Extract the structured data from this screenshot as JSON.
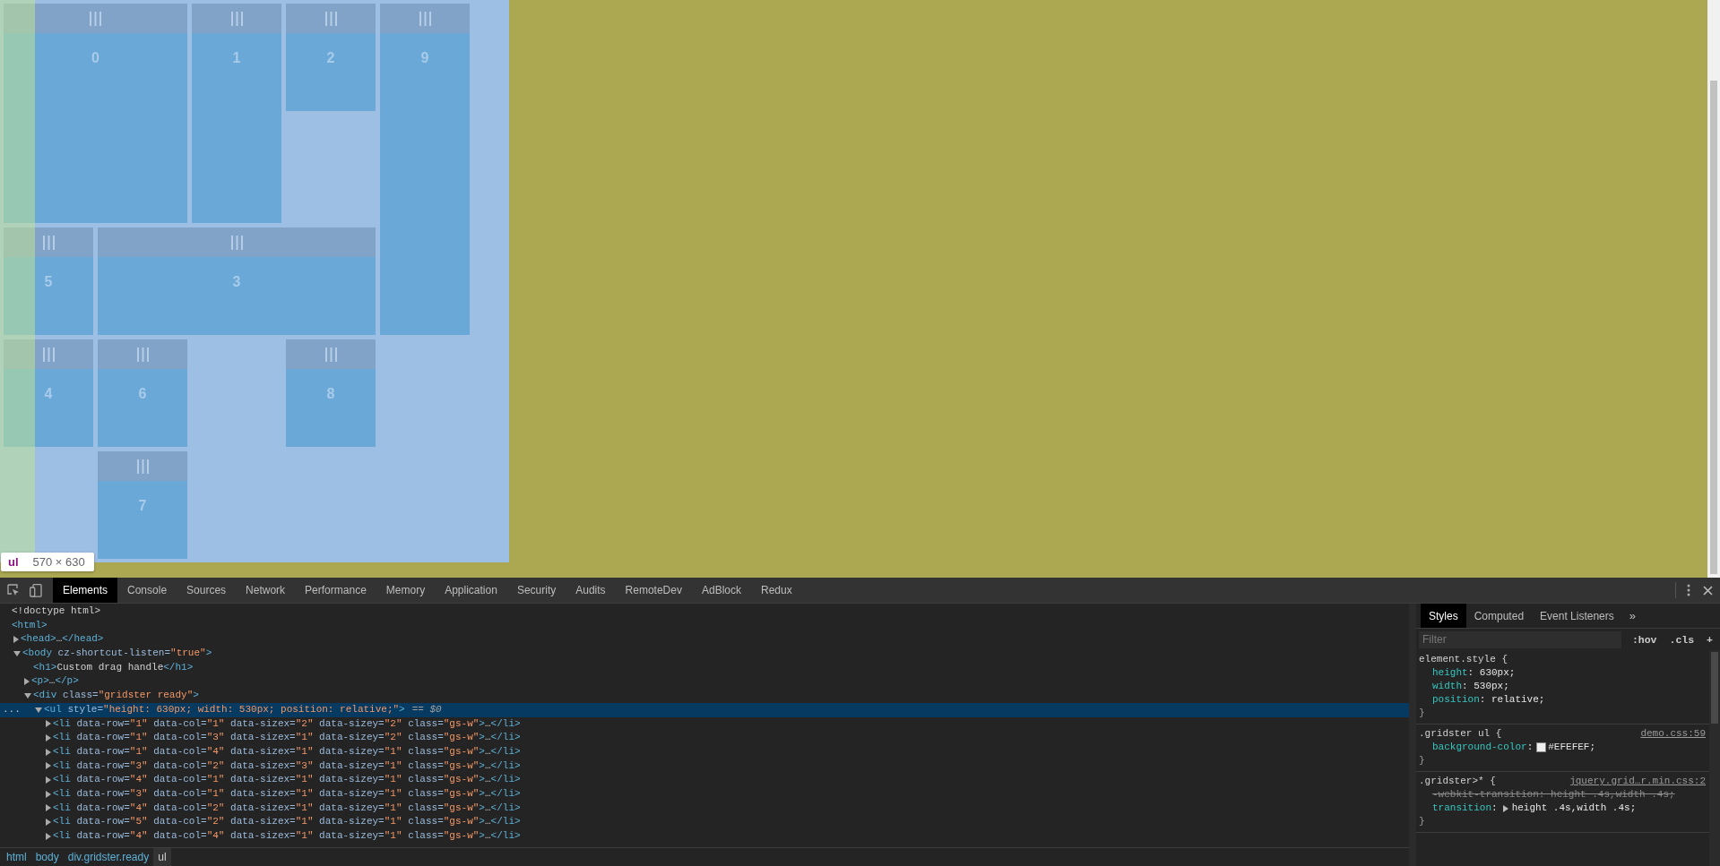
{
  "page": {
    "inspect_tooltip": {
      "tag": "ul",
      "size": "570 × 630"
    },
    "tiles": [
      {
        "label": "0"
      },
      {
        "label": "1"
      },
      {
        "label": "2"
      },
      {
        "label": "9"
      },
      {
        "label": "5"
      },
      {
        "label": "3"
      },
      {
        "label": "4"
      },
      {
        "label": "6"
      },
      {
        "label": "8"
      },
      {
        "label": "7"
      }
    ]
  },
  "devtools": {
    "tabs": [
      {
        "label": "Elements",
        "selected": true
      },
      {
        "label": "Console",
        "selected": false
      },
      {
        "label": "Sources",
        "selected": false
      },
      {
        "label": "Network",
        "selected": false
      },
      {
        "label": "Performance",
        "selected": false
      },
      {
        "label": "Memory",
        "selected": false
      },
      {
        "label": "Application",
        "selected": false
      },
      {
        "label": "Security",
        "selected": false
      },
      {
        "label": "Audits",
        "selected": false
      },
      {
        "label": "RemoteDev",
        "selected": false
      },
      {
        "label": "AdBlock",
        "selected": false
      },
      {
        "label": "Redux",
        "selected": false
      }
    ],
    "tree": [
      {
        "text": "<!doctype html>",
        "kind": "doctype",
        "selected": false
      },
      {
        "text": "<html>",
        "kind": "element",
        "selected": false,
        "children": [
          {
            "text": "<head>…</head>",
            "kind": "element",
            "selected": false,
            "expanded": false
          },
          {
            "text": "<body cz-shortcut-listen=\"true\">",
            "kind": "element",
            "selected": false,
            "expanded": true,
            "children": [
              {
                "text": "<h1>Custom drag handle</h1>",
                "kind": "element",
                "selected": false
              },
              {
                "text": "<p>…</p>",
                "kind": "element",
                "selected": false,
                "expanded": false
              },
              {
                "text": "<div class=\"gridster ready\">",
                "kind": "element",
                "selected": false,
                "expanded": true,
                "children": [
                  {
                    "text": "<ul style=\"height: 630px; width: 530px; position: relative;\">",
                    "kind": "element",
                    "selected": true,
                    "expanded": true,
                    "gutter": "...",
                    "console_ref": "== $0",
                    "children": [
                      {
                        "text": "<li data-row=\"1\" data-col=\"1\" data-sizex=\"2\" data-sizey=\"2\" class=\"gs-w\">…</li>",
                        "kind": "element",
                        "selected": false,
                        "expanded": false
                      },
                      {
                        "text": "<li data-row=\"1\" data-col=\"3\" data-sizex=\"1\" data-sizey=\"2\" class=\"gs-w\">…</li>",
                        "kind": "element",
                        "selected": false,
                        "expanded": false
                      },
                      {
                        "text": "<li data-row=\"1\" data-col=\"4\" data-sizex=\"1\" data-sizey=\"1\" class=\"gs-w\">…</li>",
                        "kind": "element",
                        "selected": false,
                        "expanded": false
                      },
                      {
                        "text": "<li data-row=\"3\" data-col=\"2\" data-sizex=\"3\" data-sizey=\"1\" class=\"gs-w\">…</li>",
                        "kind": "element",
                        "selected": false,
                        "expanded": false
                      },
                      {
                        "text": "<li data-row=\"4\" data-col=\"1\" data-sizex=\"1\" data-sizey=\"1\" class=\"gs-w\">…</li>",
                        "kind": "element",
                        "selected": false,
                        "expanded": false
                      },
                      {
                        "text": "<li data-row=\"3\" data-col=\"1\" data-sizex=\"1\" data-sizey=\"1\" class=\"gs-w\">…</li>",
                        "kind": "element",
                        "selected": false,
                        "expanded": false
                      },
                      {
                        "text": "<li data-row=\"4\" data-col=\"2\" data-sizex=\"1\" data-sizey=\"1\" class=\"gs-w\">…</li>",
                        "kind": "element",
                        "selected": false,
                        "expanded": false
                      },
                      {
                        "text": "<li data-row=\"5\" data-col=\"2\" data-sizex=\"1\" data-sizey=\"1\" class=\"gs-w\">…</li>",
                        "kind": "element",
                        "selected": false,
                        "expanded": false
                      },
                      {
                        "text": "<li data-row=\"4\" data-col=\"4\" data-sizex=\"1\" data-sizey=\"1\" class=\"gs-w\">…</li>",
                        "kind": "element",
                        "selected": false,
                        "expanded": false
                      }
                    ]
                  }
                ]
              }
            ]
          }
        ]
      }
    ],
    "breadcrumbs": [
      {
        "label": "html",
        "selected": false
      },
      {
        "label": "body",
        "selected": false
      },
      {
        "label": "div.gridster.ready",
        "selected": false
      },
      {
        "label": "ul",
        "selected": true
      }
    ],
    "sidebar": {
      "tabs": [
        {
          "label": "Styles",
          "selected": true
        },
        {
          "label": "Computed",
          "selected": false
        },
        {
          "label": "Event Listeners",
          "selected": false
        }
      ],
      "more_tabs": "»",
      "filter": {
        "placeholder": "Filter"
      },
      "buttons": [
        ":hov",
        ".cls",
        "+"
      ],
      "rules": [
        {
          "selector": "element.style {",
          "close": "}",
          "declarations": [
            {
              "property": "height",
              "value": ": 630px;",
              "struck": false,
              "expandable": false
            },
            {
              "property": "width",
              "value": ": 530px;",
              "struck": false,
              "expandable": false
            },
            {
              "property": "position",
              "value": ": relative;",
              "struck": false,
              "expandable": false
            }
          ]
        },
        {
          "selector": ".gridster ul {",
          "source": "demo.css:59",
          "close": "}",
          "declarations": [
            {
              "property": "background-color",
              "value": ": #EFEFEF;",
              "struck": false,
              "expandable": false,
              "color": "#efefef"
            }
          ]
        },
        {
          "selector": ".gridster>* {",
          "source": "jquery.grid…r.min.css:2",
          "close": "}",
          "declarations": [
            {
              "property": "-webkit-transition",
              "value": ": height .4s,width .4s;",
              "struck": true,
              "expandable": false
            },
            {
              "property": "transition",
              "value": ": height .4s,width .4s;",
              "struck": false,
              "expandable": true
            }
          ]
        }
      ]
    }
  }
}
